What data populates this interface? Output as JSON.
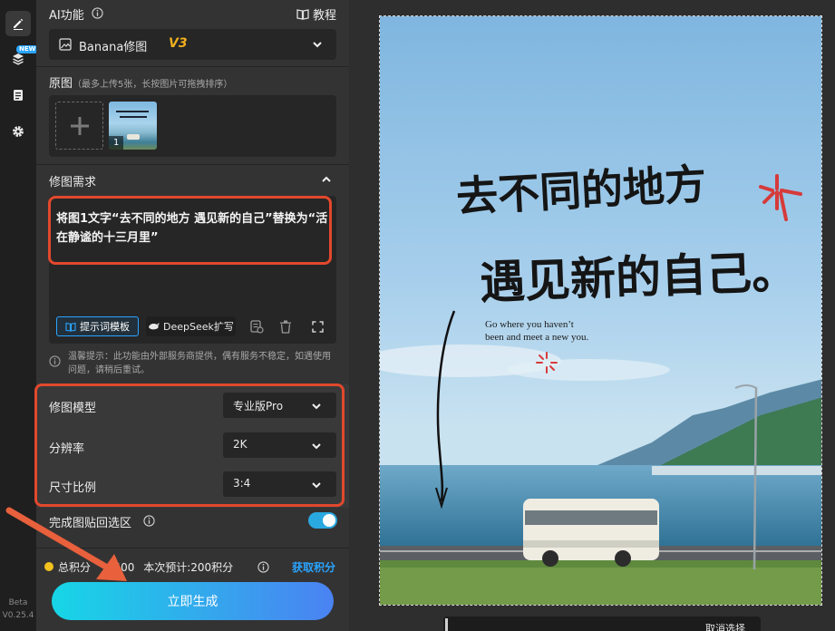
{
  "toolbar": {
    "new_badge": "NEW",
    "version_beta": "Beta",
    "version_number": "V0.25.4",
    "icons": [
      "edit-icon",
      "layers-icon",
      "document-icon",
      "gear-icon"
    ]
  },
  "ai_section": {
    "title": "AI功能",
    "tutorial": "教程",
    "model_selector": {
      "name": "Banana修图",
      "version": "V3"
    }
  },
  "source": {
    "title": "原图",
    "note": "（最多上传5张，长按图片可拖拽排序）",
    "thumb_index": "1"
  },
  "request": {
    "title": "修图需求",
    "text": "将图1文字“去不同的地方 遇见新的自己”替换为“活在静谧的十三月里”",
    "template_button": "提示词模板",
    "deepseek_button": "DeepSeek扩写"
  },
  "notice": {
    "text": "温馨提示：此功能由外部服务商提供，偶有服务不稳定，如遇使用问题，请稍后重试。"
  },
  "params": {
    "model_label": "修图模型",
    "model_value": "专业版Pro",
    "resolution_label": "分辨率",
    "resolution_value": "2K",
    "ratio_label": "尺寸比例",
    "ratio_value": "3:4"
  },
  "paste_back": {
    "label": "完成图贴回选区",
    "enabled": true
  },
  "points": {
    "total_label": "总积分",
    "total_value": "9400",
    "estimate": "本次预计:200积分",
    "get_points": "获取积分"
  },
  "generate_button": "立即生成",
  "poster": {
    "line1": "去不同的地方",
    "line2": "遇见新的自己。",
    "english_line1": "Go where you haven’t",
    "english_line2": "been and meet a new you."
  },
  "bottom_bar": {
    "cancel_selection": "取消选择"
  },
  "colors": {
    "accent_blue": "#2aa4ff",
    "highlight_red": "#e2482d",
    "v3_gold": "#f2b01e",
    "gen_gradient_start": "#17d6e6",
    "gen_gradient_end": "#4b82f2",
    "points_link": "#2aa4ff"
  }
}
